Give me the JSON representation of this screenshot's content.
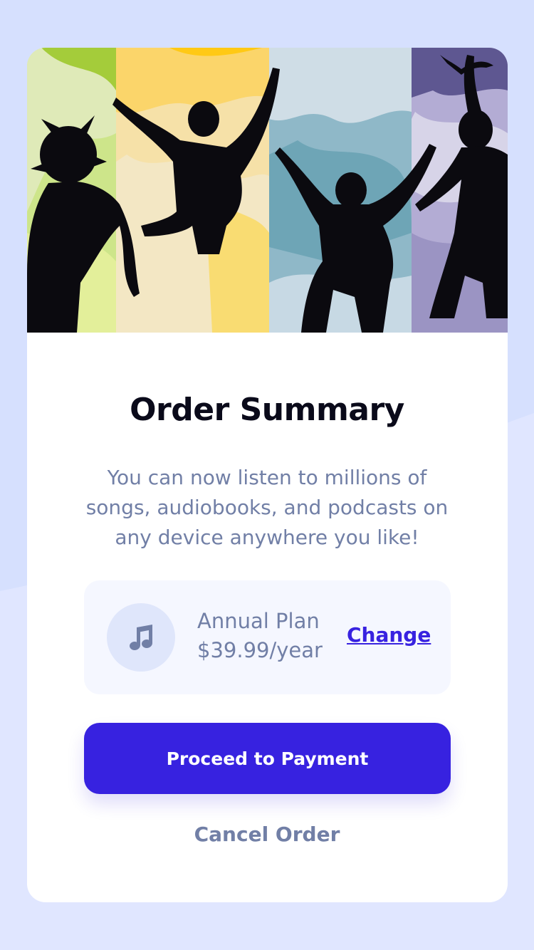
{
  "colors": {
    "background": "#d6e0fe",
    "accent": "#3722e0",
    "muted_text": "#717fa6",
    "title_text": "#0a0a1a"
  },
  "hero": {
    "icon": "people-jumping-illustration"
  },
  "summary": {
    "title": "Order Summary",
    "description": "You can now listen to millions of songs, audiobooks, and podcasts on any device anywhere you like!"
  },
  "plan": {
    "icon": "music-note-icon",
    "name": "Annual Plan",
    "price": "$39.99/year",
    "change_label": "Change"
  },
  "actions": {
    "proceed_label": "Proceed to Payment",
    "cancel_label": "Cancel Order"
  }
}
